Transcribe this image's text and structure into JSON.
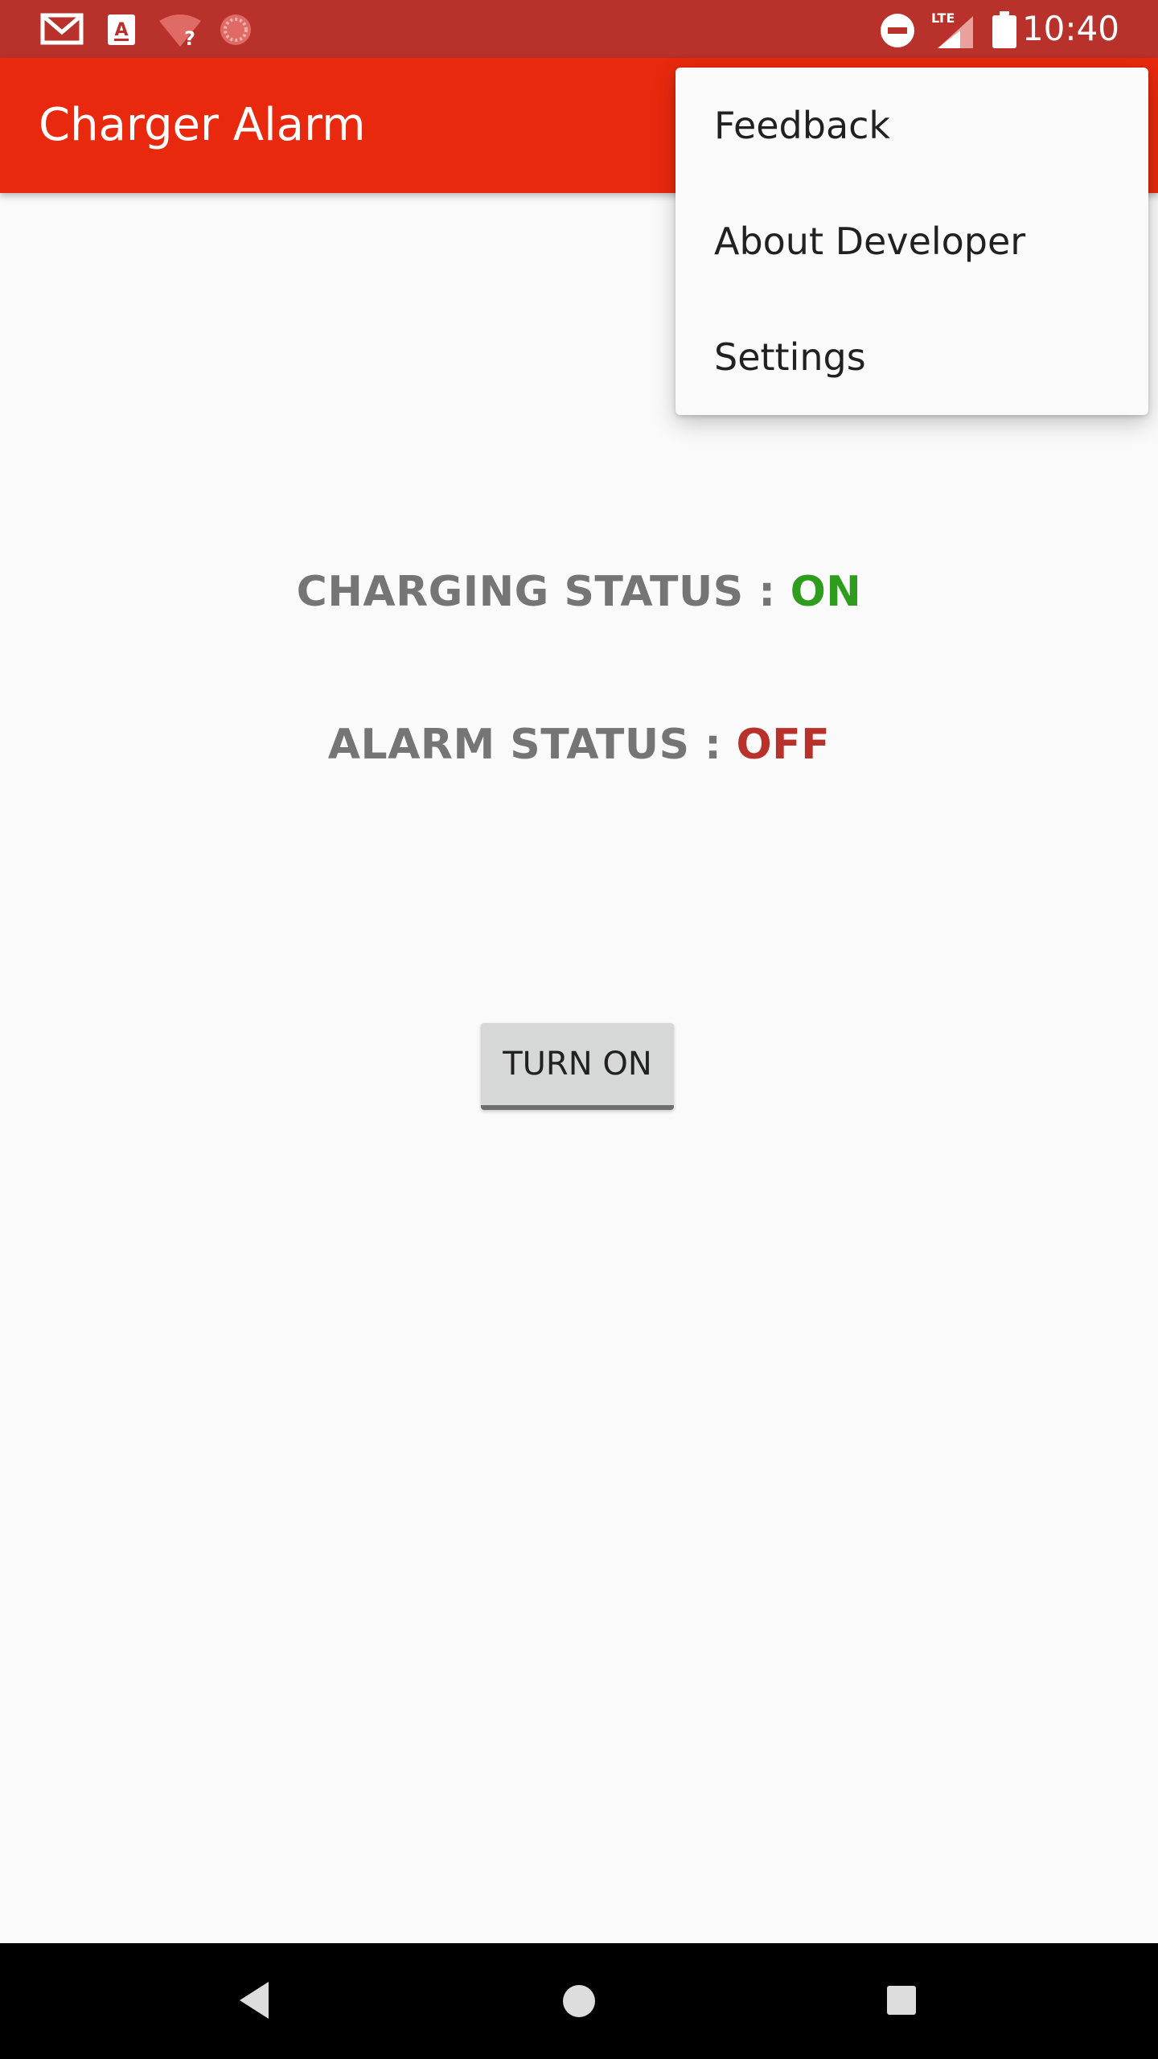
{
  "status_bar": {
    "time": "10:40",
    "left_icons": [
      "gmail-icon",
      "app-notification-icon",
      "wifi-unknown-icon",
      "sync-icon"
    ],
    "right_icons": [
      "do-not-disturb-icon",
      "lte-signal-icon",
      "battery-icon"
    ],
    "lte_label": "LTE",
    "color": "#b8312b"
  },
  "app_bar": {
    "title": "Charger Alarm",
    "color": "#e8290e"
  },
  "overflow_menu": {
    "items": [
      {
        "label": "Feedback"
      },
      {
        "label": "About Developer"
      },
      {
        "label": "Settings"
      }
    ]
  },
  "main": {
    "charging_status": {
      "label": "CHARGING STATUS :",
      "value": "ON",
      "value_color": "#2e9c1c"
    },
    "alarm_status": {
      "label": "ALARM STATUS :",
      "value": "OFF",
      "value_color": "#b8312b"
    },
    "action_button": {
      "label": "TURN ON"
    }
  },
  "nav_bar": {
    "buttons": [
      "back-icon",
      "home-icon",
      "recents-icon"
    ]
  }
}
